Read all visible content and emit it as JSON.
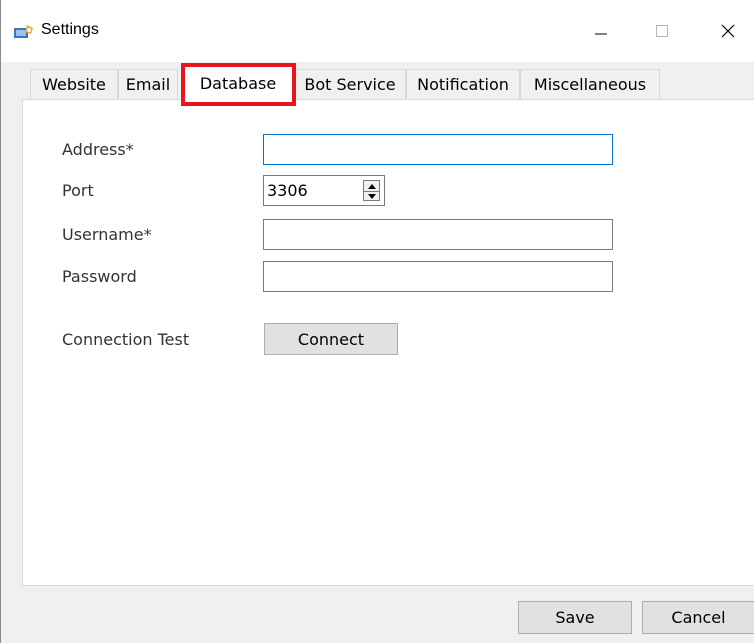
{
  "window": {
    "title": "Settings"
  },
  "tabs": [
    {
      "label": "Website"
    },
    {
      "label": "Email"
    },
    {
      "label": "Database"
    },
    {
      "label": "Bot Service"
    },
    {
      "label": "Notification"
    },
    {
      "label": "Miscellaneous"
    }
  ],
  "selected_tab": "Database",
  "form": {
    "address_label": "Address*",
    "address_value": "",
    "port_label": "Port",
    "port_value": "3306",
    "username_label": "Username*",
    "username_value": "",
    "password_label": "Password",
    "password_value": "",
    "connection_test_label": "Connection Test",
    "connect_button": "Connect"
  },
  "footer": {
    "save_button": "Save",
    "cancel_button": "Cancel"
  },
  "colors": {
    "highlight": "#e8151b",
    "focus_border": "#0078d7"
  },
  "icons": {
    "app": "settings-app-icon",
    "minimize": "minimize-icon",
    "maximize": "maximize-icon",
    "close": "close-icon"
  }
}
